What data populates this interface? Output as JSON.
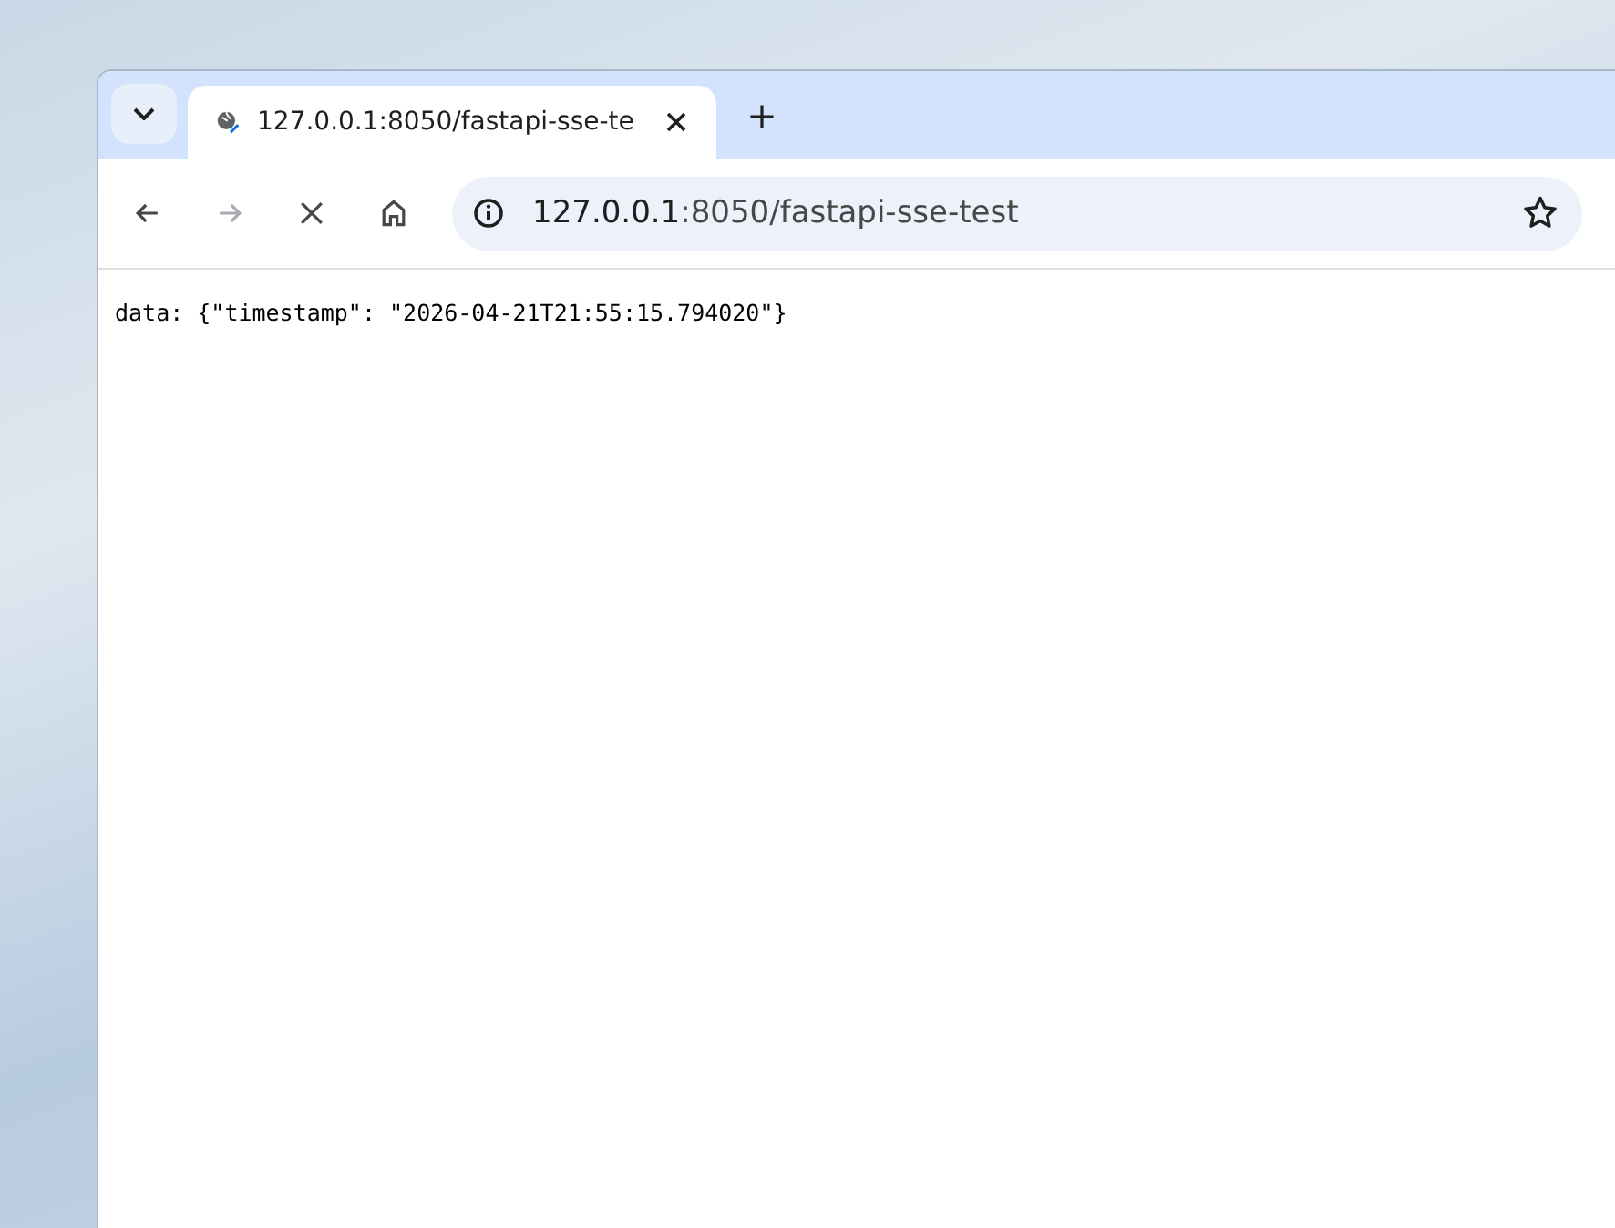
{
  "tabs": [
    {
      "title": "127.0.0.1:8050/fastapi-sse-te",
      "selected": true
    }
  ],
  "toolbar": {
    "buttons": [
      {
        "kind": "back",
        "disabled": false
      },
      {
        "kind": "forward",
        "disabled": true
      },
      {
        "kind": "stop",
        "disabled": false
      },
      {
        "kind": "home",
        "disabled": false
      }
    ],
    "address": {
      "host": "127.0.0.1",
      "path": ":8050/fastapi-sse-test"
    }
  },
  "page": {
    "text": "data: {\"timestamp\": \"2026-04-21T21:55:15.794020\"}"
  }
}
